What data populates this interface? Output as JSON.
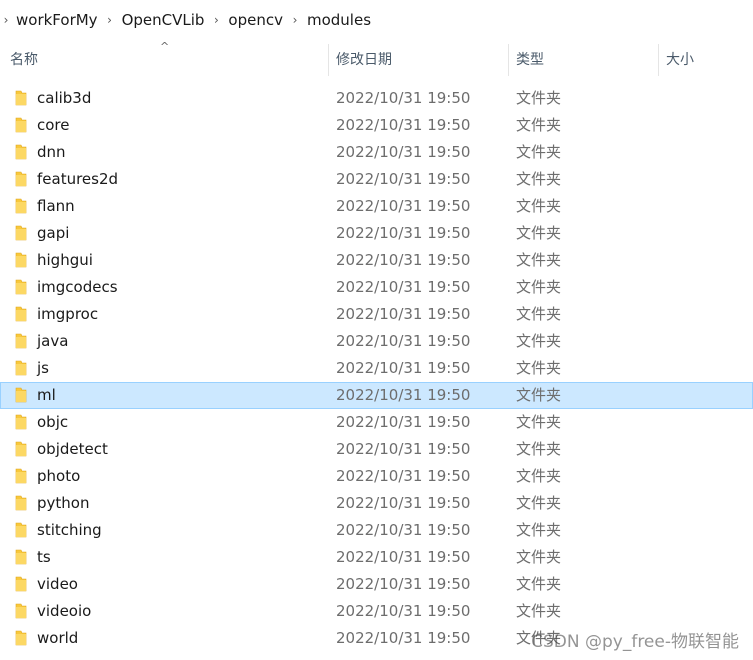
{
  "breadcrumb": {
    "items": [
      "workForMy",
      "OpenCVLib",
      "opencv",
      "modules"
    ]
  },
  "columns": {
    "name": "名称",
    "date": "修改日期",
    "type": "类型",
    "size": "大小"
  },
  "sort_indicator": "^",
  "rows": [
    {
      "name": "calib3d",
      "date": "2022/10/31 19:50",
      "type": "文件夹"
    },
    {
      "name": "core",
      "date": "2022/10/31 19:50",
      "type": "文件夹"
    },
    {
      "name": "dnn",
      "date": "2022/10/31 19:50",
      "type": "文件夹"
    },
    {
      "name": "features2d",
      "date": "2022/10/31 19:50",
      "type": "文件夹"
    },
    {
      "name": "flann",
      "date": "2022/10/31 19:50",
      "type": "文件夹"
    },
    {
      "name": "gapi",
      "date": "2022/10/31 19:50",
      "type": "文件夹"
    },
    {
      "name": "highgui",
      "date": "2022/10/31 19:50",
      "type": "文件夹"
    },
    {
      "name": "imgcodecs",
      "date": "2022/10/31 19:50",
      "type": "文件夹"
    },
    {
      "name": "imgproc",
      "date": "2022/10/31 19:50",
      "type": "文件夹"
    },
    {
      "name": "java",
      "date": "2022/10/31 19:50",
      "type": "文件夹"
    },
    {
      "name": "js",
      "date": "2022/10/31 19:50",
      "type": "文件夹"
    },
    {
      "name": "ml",
      "date": "2022/10/31 19:50",
      "type": "文件夹",
      "selected": true
    },
    {
      "name": "objc",
      "date": "2022/10/31 19:50",
      "type": "文件夹"
    },
    {
      "name": "objdetect",
      "date": "2022/10/31 19:50",
      "type": "文件夹"
    },
    {
      "name": "photo",
      "date": "2022/10/31 19:50",
      "type": "文件夹"
    },
    {
      "name": "python",
      "date": "2022/10/31 19:50",
      "type": "文件夹"
    },
    {
      "name": "stitching",
      "date": "2022/10/31 19:50",
      "type": "文件夹"
    },
    {
      "name": "ts",
      "date": "2022/10/31 19:50",
      "type": "文件夹"
    },
    {
      "name": "video",
      "date": "2022/10/31 19:50",
      "type": "文件夹"
    },
    {
      "name": "videoio",
      "date": "2022/10/31 19:50",
      "type": "文件夹"
    },
    {
      "name": "world",
      "date": "2022/10/31 19:50",
      "type": "文件夹"
    }
  ],
  "watermark": "CSDN @py_free-物联智能",
  "colors": {
    "selection_bg": "#cce8ff",
    "selection_border": "#99d1ff",
    "folder_yellow": "#f8c83c",
    "header_text": "#4a5a6a",
    "secondary_text": "#6d6d6d"
  },
  "icons": {
    "breadcrumb_separator": "chevron-right-icon",
    "folder": "folder-icon",
    "sort": "sort-ascending-icon"
  }
}
